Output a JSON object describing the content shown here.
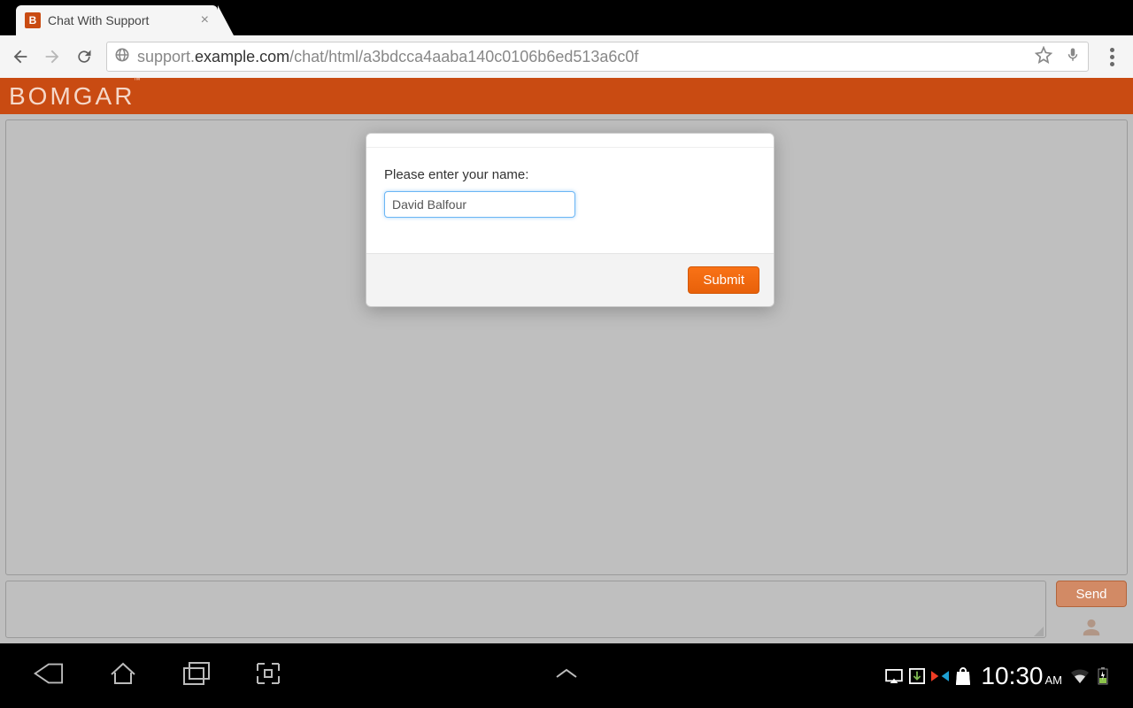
{
  "browser": {
    "tab_title": "Chat With Support",
    "tab_favicon_letter": "B",
    "url_prefix": "support.",
    "url_domain": "example.com",
    "url_path": "/chat/html/a3bdcca4aaba140c0106b6ed513a6c0f"
  },
  "brand": {
    "name": "BOMGAR",
    "trademark": "™"
  },
  "modal": {
    "label": "Please enter your name:",
    "input_value": "David Balfour",
    "submit_label": "Submit"
  },
  "chat": {
    "send_label": "Send"
  },
  "android": {
    "clock_time": "10:30",
    "clock_ampm": "AM"
  },
  "colors": {
    "brand": "#c94b12",
    "submit": "#f06b13"
  }
}
